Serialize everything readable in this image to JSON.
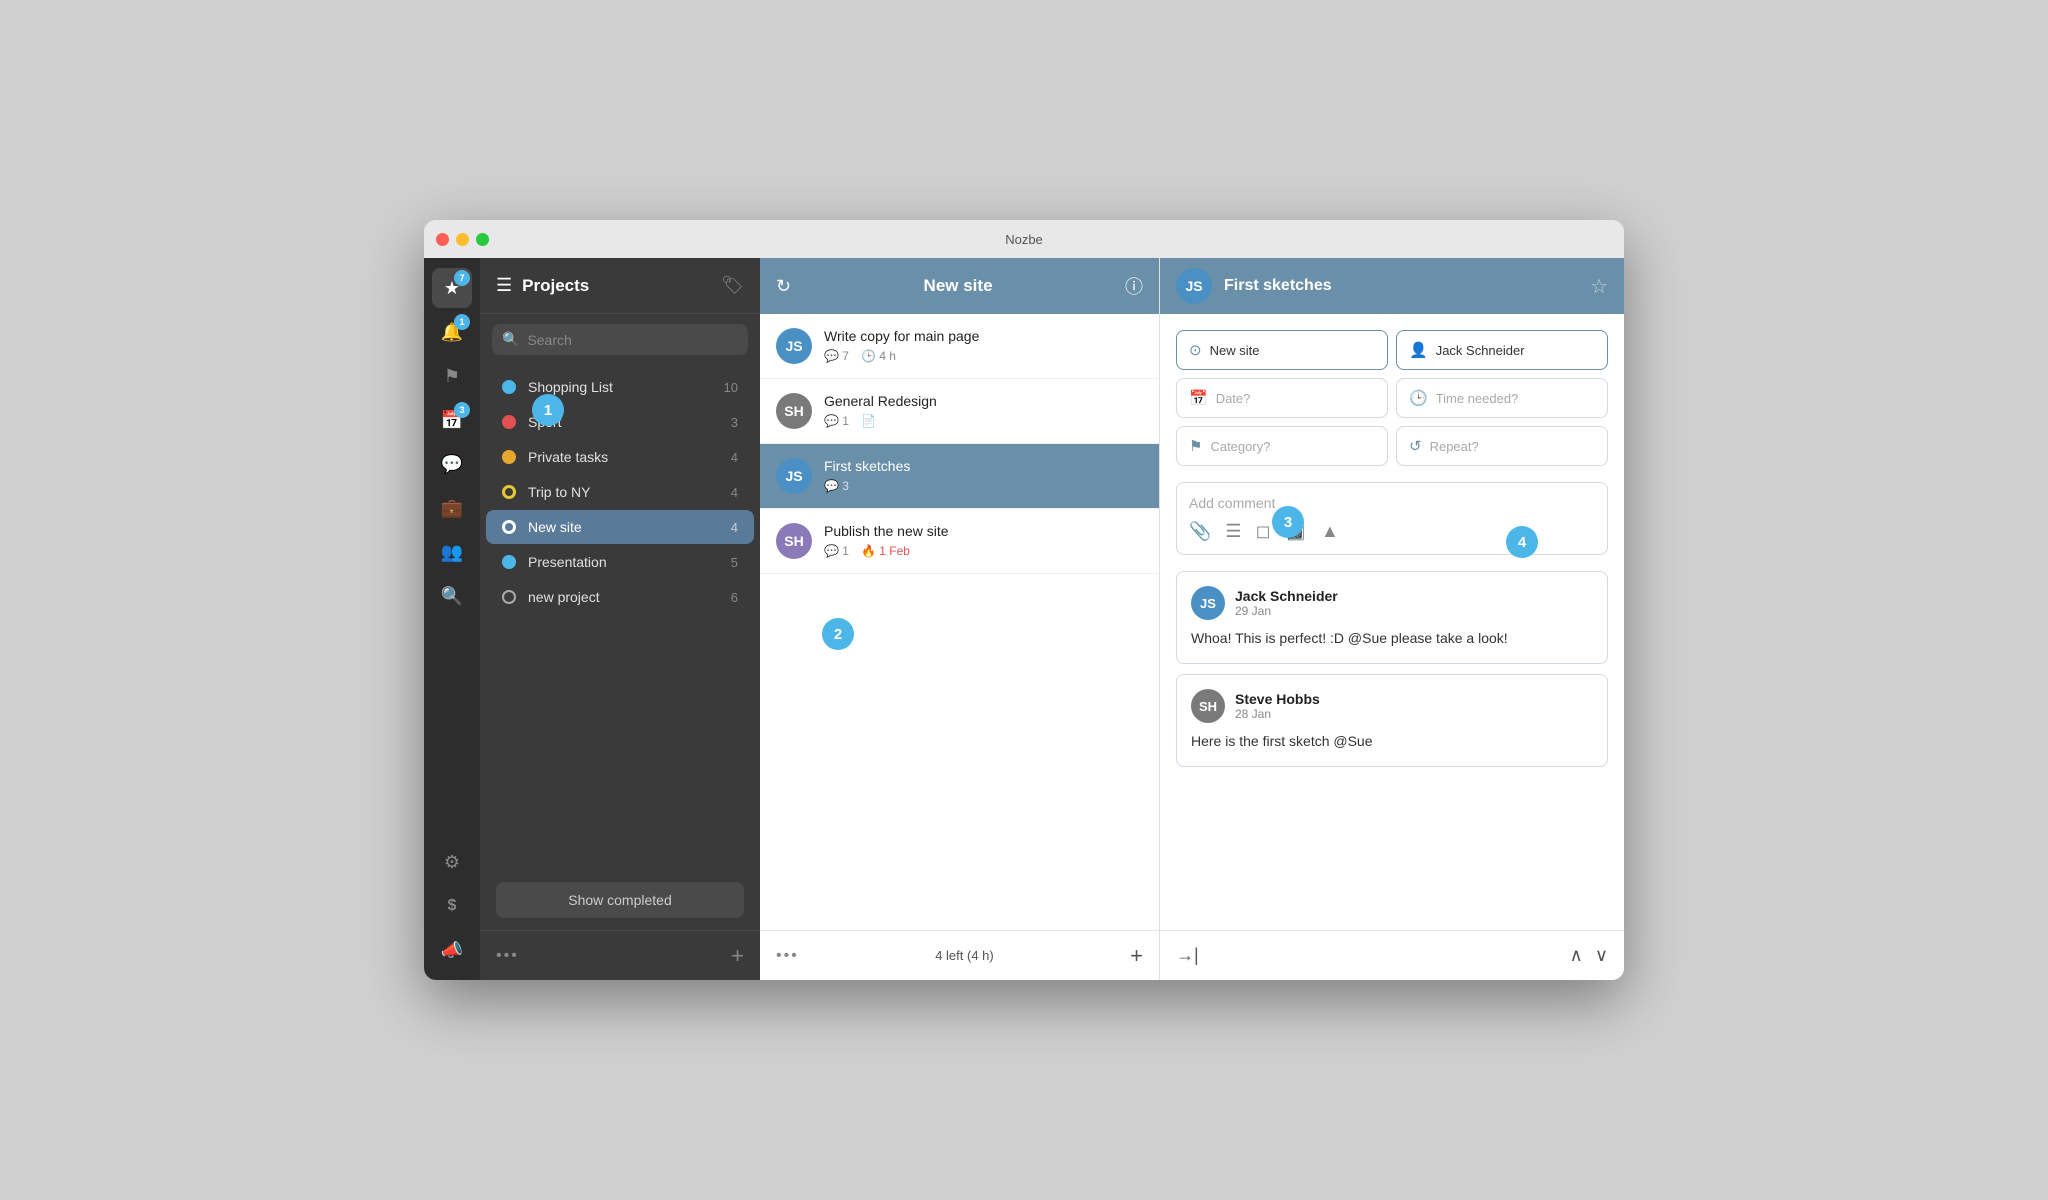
{
  "app": {
    "title": "Nozbe"
  },
  "sidebar_icons": [
    {
      "name": "star-icon",
      "symbol": "★",
      "badge": "7",
      "badge_color": "blue"
    },
    {
      "name": "bell-icon",
      "symbol": "🔔",
      "badge": "1",
      "badge_color": "blue"
    },
    {
      "name": "flag-icon",
      "symbol": "⚑",
      "badge": null
    },
    {
      "name": "calendar-icon",
      "symbol": "📅",
      "badge": "3",
      "badge_color": "blue"
    },
    {
      "name": "chat-icon",
      "symbol": "💬",
      "badge": null
    },
    {
      "name": "briefcase-icon",
      "symbol": "💼",
      "badge": null
    },
    {
      "name": "people-icon",
      "symbol": "👥",
      "badge": null
    },
    {
      "name": "search-icon",
      "symbol": "🔍",
      "badge": null
    },
    {
      "name": "settings-icon",
      "symbol": "⚙",
      "badge": null
    },
    {
      "name": "dollar-icon",
      "symbol": "$",
      "badge": null
    },
    {
      "name": "megaphone-icon",
      "symbol": "📣",
      "badge": null
    }
  ],
  "projects": {
    "header": {
      "title": "Projects",
      "icon": "≡",
      "tag_icon": "🏷"
    },
    "search": {
      "placeholder": "Search"
    },
    "items": [
      {
        "name": "Shopping List",
        "color": "#4db6e8",
        "count": 10,
        "dot_style": "filled"
      },
      {
        "name": "Sport",
        "color": "#e05252",
        "count": 3,
        "dot_style": "filled"
      },
      {
        "name": "Private tasks",
        "color": "#e8a830",
        "count": 4,
        "dot_style": "filled"
      },
      {
        "name": "Trip to NY",
        "color": "#e8c830",
        "count": 4,
        "dot_style": "ring"
      },
      {
        "name": "New site",
        "color": "#4db6e8",
        "count": 4,
        "dot_style": "ring"
      },
      {
        "name": "Presentation",
        "color": "#4db6e8",
        "count": 5,
        "dot_style": "filled"
      },
      {
        "name": "new project",
        "color": "#ffffff",
        "count": 6,
        "dot_style": "ring"
      }
    ],
    "show_completed_label": "Show completed",
    "footer": {
      "dots": "•••",
      "plus": "+"
    }
  },
  "tasks": {
    "header": {
      "title": "New site",
      "refresh_icon": "↻",
      "info_icon": "ⓘ"
    },
    "items": [
      {
        "id": 1,
        "name": "Write copy for main page",
        "avatar_initials": "JS",
        "avatar_color": "blue",
        "comment_count": 7,
        "time": "4 h",
        "selected": false
      },
      {
        "id": 2,
        "name": "General Redesign",
        "avatar_initials": "SH",
        "avatar_color": "gray",
        "comment_count": 1,
        "has_note": true,
        "selected": false
      },
      {
        "id": 3,
        "name": "First sketches",
        "avatar_initials": "JS",
        "avatar_color": "blue",
        "comment_count": 3,
        "selected": true
      },
      {
        "id": 4,
        "name": "Publish the new site",
        "avatar_initials": "SH",
        "avatar_color": "purple",
        "comment_count": 1,
        "due_date": "1 Feb",
        "selected": false
      }
    ],
    "footer": {
      "dots": "•••",
      "status": "4 left (4 h)",
      "plus": "+"
    }
  },
  "detail": {
    "task_name": "First sketches",
    "avatar_initials": "JS",
    "fields": {
      "project": "New site",
      "assignee": "Jack Schneider",
      "date_placeholder": "Date?",
      "time_placeholder": "Time needed?",
      "category_placeholder": "Category?",
      "repeat_placeholder": "Repeat?"
    },
    "comment_placeholder": "Add comment",
    "comments": [
      {
        "author": "Jack Schneider",
        "date": "29 Jan",
        "text": "Whoa! This is perfect! :D @Sue please take a look!",
        "avatar_initials": "JS",
        "avatar_color": "blue"
      },
      {
        "author": "Steve Hobbs",
        "date": "28 Jan",
        "text": "Here is the first sketch @Sue",
        "avatar_initials": "SH",
        "avatar_color": "gray"
      }
    ],
    "footer": {
      "arrow": "→|",
      "up": "∧",
      "down": "∨"
    }
  },
  "badges": [
    {
      "label": "1",
      "id": "badge-one"
    },
    {
      "label": "2",
      "id": "badge-two"
    },
    {
      "label": "3",
      "id": "badge-three"
    },
    {
      "label": "4",
      "id": "badge-four"
    }
  ]
}
